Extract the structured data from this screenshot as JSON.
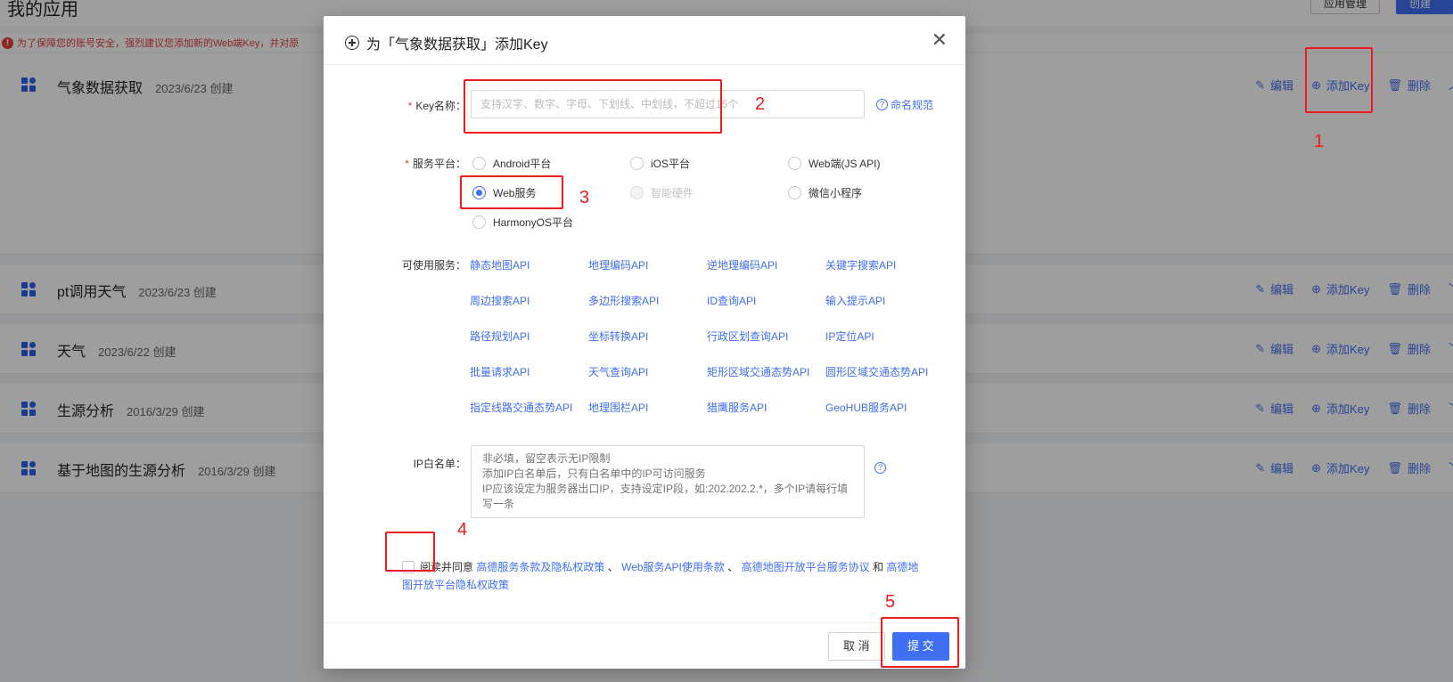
{
  "page": {
    "title": "我的应用",
    "btn_guide": "应用管理",
    "btn_create": "创建新应用",
    "warning": "为了保障您的账号安全，强烈建议您添加新的Web端Key，并对原"
  },
  "apps": [
    {
      "name": "气象数据获取",
      "date": "2023/6/23 创建"
    },
    {
      "name": "pt调用天气",
      "date": "2023/6/23 创建"
    },
    {
      "name": "天气",
      "date": "2023/6/22 创建"
    },
    {
      "name": "生源分析",
      "date": "2016/3/29 创建"
    },
    {
      "name": "基于地图的生源分析",
      "date": "2016/3/29 创建"
    }
  ],
  "row_actions": {
    "edit": "编辑",
    "add_key": "添加Key",
    "delete": "删除"
  },
  "modal": {
    "title": "为「气象数据获取」添加Key",
    "key_label": "Key名称：",
    "key_placeholder": "支持汉字、数字、字母、下划线、中划线，不超过15个",
    "naming_rule": "命名规范",
    "platform_label": "服务平台：",
    "platforms": [
      {
        "label": "Android平台",
        "checked": false,
        "disabled": false
      },
      {
        "label": "iOS平台",
        "checked": false,
        "disabled": false
      },
      {
        "label": "Web端(JS API)",
        "checked": false,
        "disabled": false
      },
      {
        "label": "Web服务",
        "checked": true,
        "disabled": false
      },
      {
        "label": "智能硬件",
        "checked": false,
        "disabled": true
      },
      {
        "label": "微信小程序",
        "checked": false,
        "disabled": false
      },
      {
        "label": "HarmonyOS平台",
        "checked": false,
        "disabled": false
      }
    ],
    "services_label": "可使用服务：",
    "services": [
      "静态地图API",
      "地理编码API",
      "逆地理编码API",
      "关键字搜索API",
      "周边搜索API",
      "多边形搜索API",
      "ID查询API",
      "输入提示API",
      "路径规划API",
      "坐标转换API",
      "行政区划查询API",
      "IP定位API",
      "批量请求API",
      "天气查询API",
      "矩形区域交通态势API",
      "圆形区域交通态势API",
      "指定线路交通态势API",
      "地理围栏API",
      "猎鹰服务API",
      "GeoHUB服务API"
    ],
    "ip_label": "IP白名单：",
    "ip_placeholder": "非必填，留空表示无IP限制\n添加IP白名单后，只有白名单中的IP可访问服务\nIP应该设定为服务器出口IP，支持设定IP段，如:202.202.2.*，多个IP请每行填写一条",
    "agree_prefix": "阅读并同意",
    "agree_link1": "高德服务条款及隐私权政策",
    "sep": "、",
    "agree_link2": "Web服务API使用条款",
    "agree_link3": "高德地图开放平台服务协议",
    "and": "和",
    "agree_link4": "高德地图开放平台隐私权政策",
    "cancel": "取 消",
    "submit": "提 交"
  },
  "annotations": [
    "1",
    "2",
    "3",
    "4",
    "5"
  ],
  "colors": {
    "accent": "#3f6ff2",
    "annotation": "#ee1c1c",
    "warning": "#e04040"
  }
}
